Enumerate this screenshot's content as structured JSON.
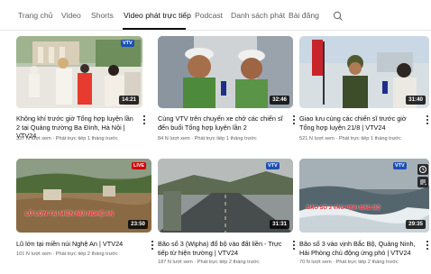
{
  "tabs": [
    {
      "label": "Trang chủ"
    },
    {
      "label": "Video"
    },
    {
      "label": "Shorts"
    },
    {
      "label": "Video phát trực tiếp",
      "active": true
    },
    {
      "label": "Podcast"
    },
    {
      "label": "Danh sách phát"
    },
    {
      "label": "Bài đăng"
    }
  ],
  "search_icon": "search-icon",
  "videos": [
    {
      "title": "Không khí trước giờ Tổng hợp luyện lần 2 tại Quảng trường Ba Đình, Hà Nội | VTV24",
      "meta": "337 N lượt xem · Phát trực tiếp 1 tháng trước",
      "duration": "14:21",
      "channel_logo": "VTV"
    },
    {
      "title": "Cùng VTV trên chuyến xe chở các chiến sĩ đến buổi Tổng hợp luyện lần 2",
      "meta": "84 N lượt xem · Phát trực tiếp 1 tháng trước",
      "duration": "32:46"
    },
    {
      "title": "Giao lưu cùng các chiến sĩ trước giờ Tổng hợp luyện 21/8 | VTV24",
      "meta": "521 N lượt xem · Phát trực tiếp 1 tháng trước",
      "duration": "31:40"
    },
    {
      "title": "Lũ lớn tại miền núi Nghệ An | VTV24",
      "meta": "101 N lượt xem · Phát trực tiếp 2 tháng trước",
      "duration": "23:50",
      "overlay": "LŨ LỚN TẠI MIỀN NÚI NGHỆ AN",
      "badge": "LIVE"
    },
    {
      "title": "Bão số 3 (Wipha) đổ bộ vào đất liền - Trực tiếp từ hiện trường | VTV24",
      "meta": "187 N lượt xem · Phát trực tiếp 2 tháng trước",
      "duration": "31:31",
      "channel_logo": "VTV"
    },
    {
      "title": "Bão số 3 vào vịnh Bắc Bộ, Quảng Ninh, Hải Phòng chủ động ứng phó | VTV24",
      "meta": "70 N lượt xem · Phát trực tiếp 2 tháng trước",
      "duration": "29:35",
      "overlay": "BÃO SỐ 3 VÀO VỊNH BẮC BỘ",
      "channel_logo": "VTV"
    }
  ],
  "colors": {
    "active_tab": "#0f0f0f",
    "inactive_tab": "#606060",
    "overlay_red": "#e0262f",
    "live_badge": "#cc0000"
  }
}
